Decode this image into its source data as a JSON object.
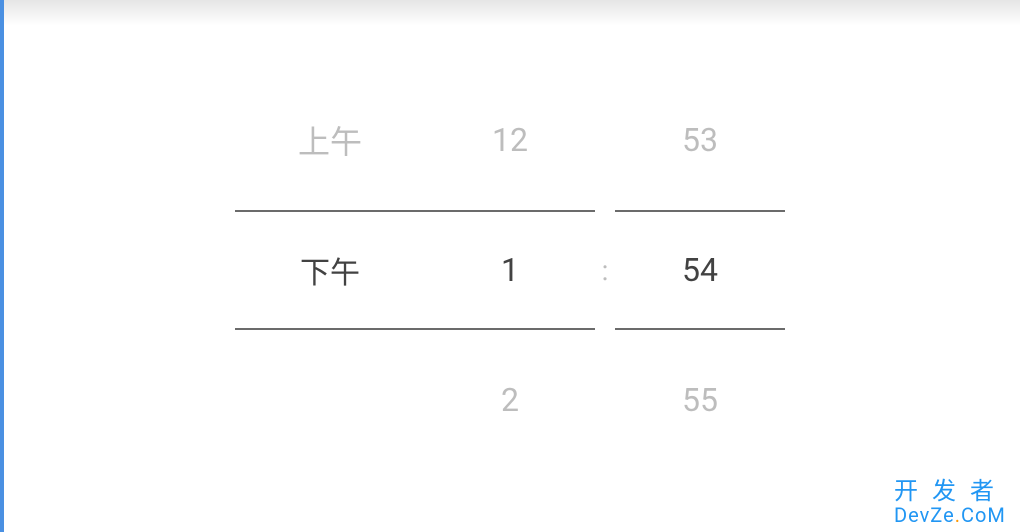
{
  "picker": {
    "ampm": {
      "prev": "上午",
      "current": "下午",
      "next": ""
    },
    "hour": {
      "prev": "12",
      "current": "1",
      "next": "2"
    },
    "minute": {
      "prev": "53",
      "current": "54",
      "next": "55"
    },
    "separator": ":"
  },
  "watermark": {
    "line1": "开发者",
    "line2_pre": "DevZe",
    "line2_dot": ".",
    "line2_post": "CoM"
  }
}
